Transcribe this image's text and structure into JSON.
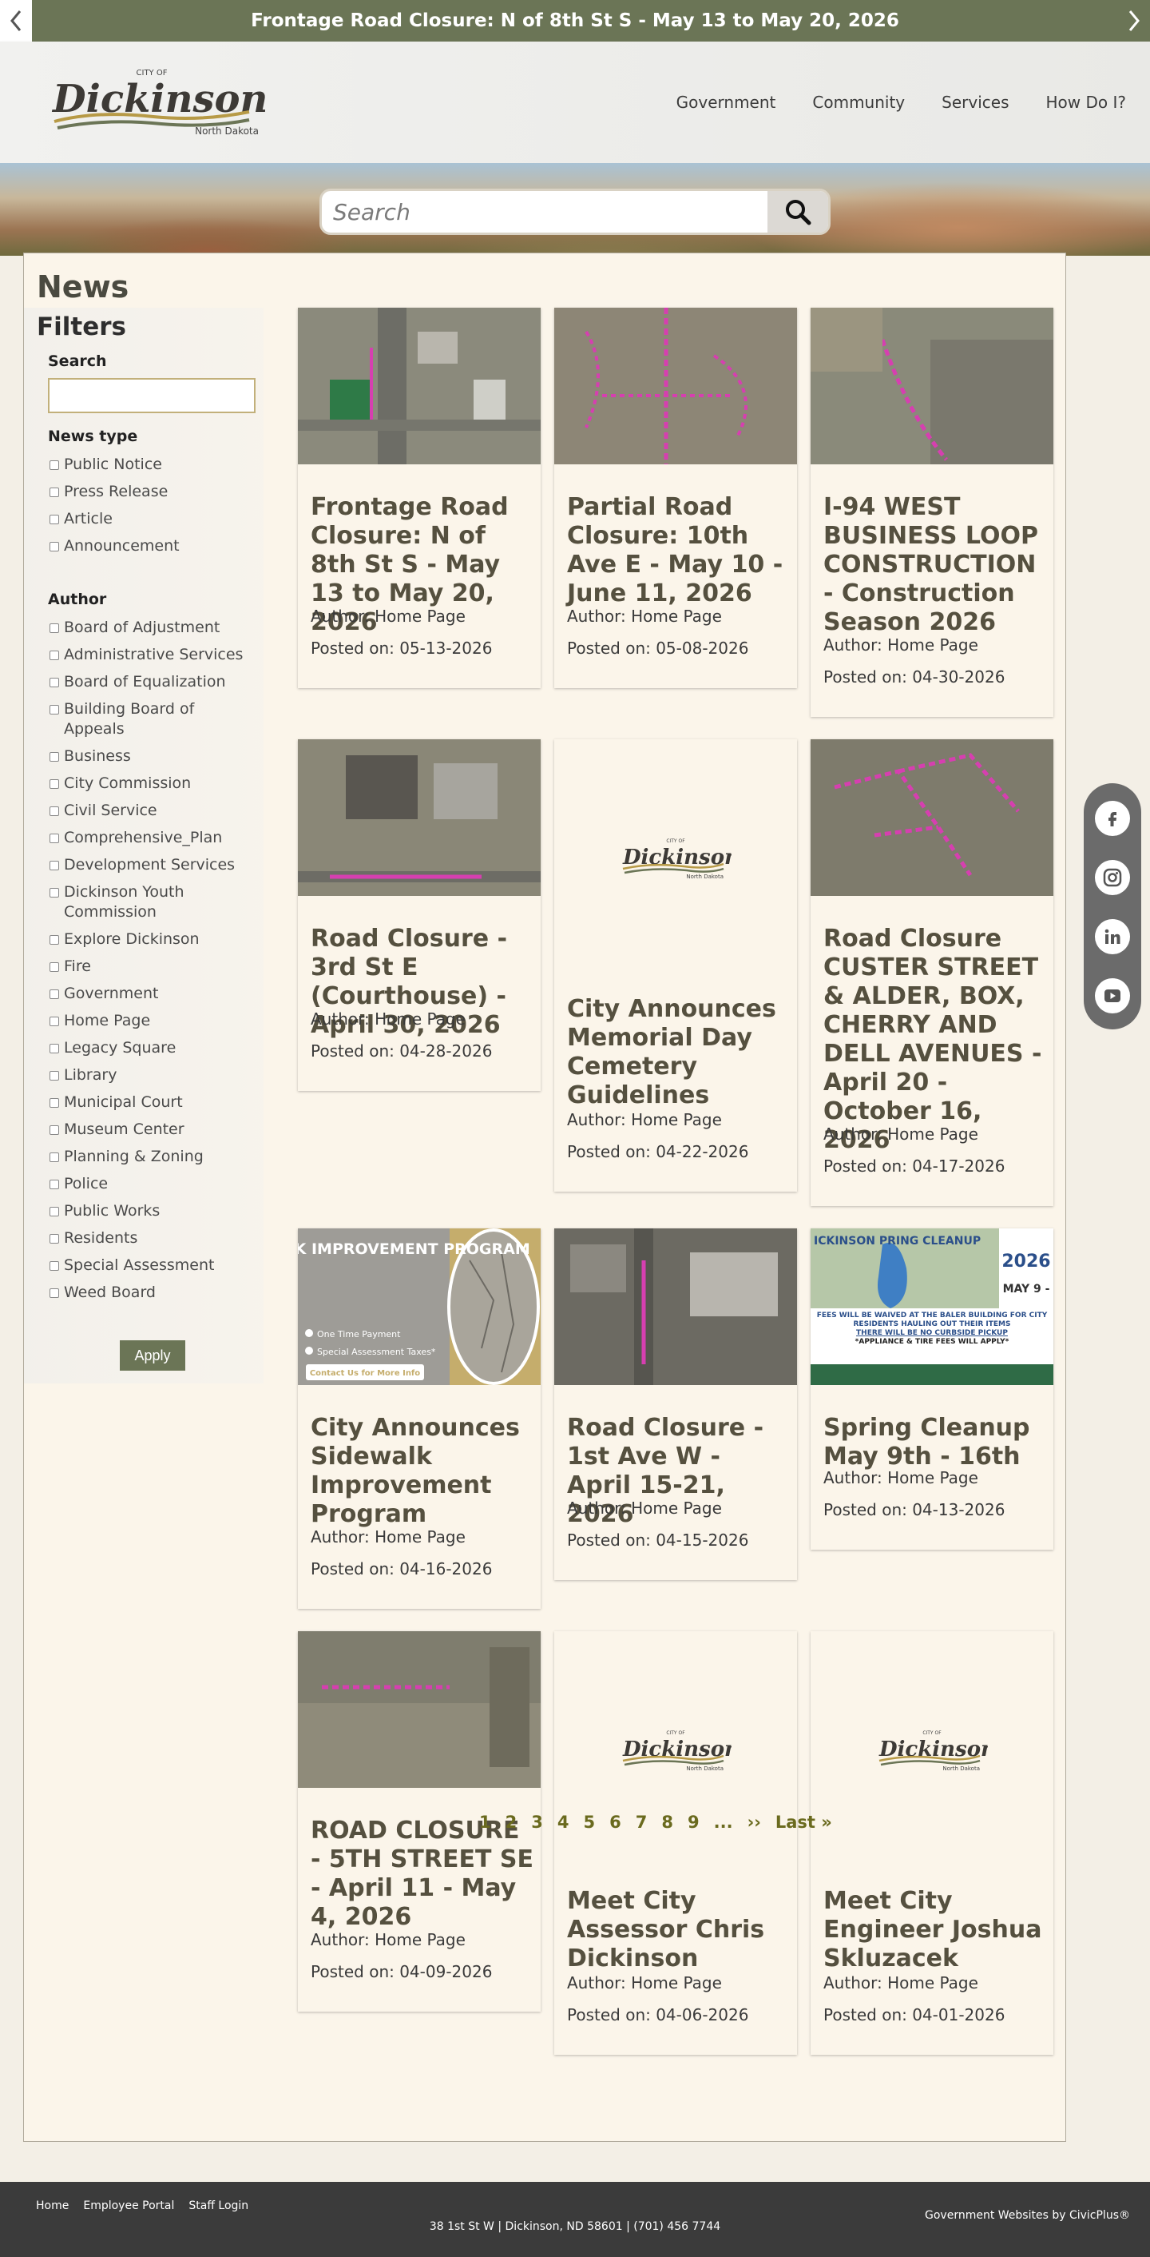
{
  "alert": {
    "text": "Frontage Road Closure: N of 8th St S - May 13 to May 20, 2026"
  },
  "header": {
    "logo": {
      "top_text": "CITY OF",
      "main_text": "Dickinson",
      "sub_text": "North Dakota"
    },
    "nav": [
      "Government",
      "Community",
      "Services",
      "How Do I?"
    ]
  },
  "search": {
    "placeholder": "Search"
  },
  "page": {
    "title": "News"
  },
  "filters": {
    "title": "Filters",
    "search_label": "Search",
    "news_type_label": "News type",
    "news_types": [
      "Public Notice",
      "Press Release",
      "Article",
      "Announcement"
    ],
    "author_label": "Author",
    "authors": [
      "Board of Adjustment",
      "Administrative Services",
      "Board of Equalization",
      "Building Board of Appeals",
      "Business",
      "City Commission",
      "Civil Service",
      "Comprehensive_Plan",
      "Development Services",
      "Dickinson Youth Commission",
      "Explore Dickinson",
      "Fire",
      "Government",
      "Home Page",
      "Legacy Square",
      "Library",
      "Municipal Court",
      "Museum Center",
      "Planning & Zoning",
      "Police",
      "Public Works",
      "Residents",
      "Special Assessment",
      "Weed Board"
    ],
    "apply_label": "Apply"
  },
  "cards": [
    {
      "title": "Frontage Road Closure: N of 8th St S - May 13 to May 20, 2026",
      "author": "Author: Home Page",
      "date": "Posted on: 05-13-2026"
    },
    {
      "title": "Partial Road Closure: 10th Ave E - May 10 - June 11, 2026",
      "author": "Author: Home Page",
      "date": "Posted on: 05-08-2026"
    },
    {
      "title": "I-94 WEST BUSINESS LOOP CONSTRUCTION - Construction Season 2026",
      "author": "Author: Home Page",
      "date": "Posted on: 04-30-2026"
    },
    {
      "title": "Road Closure - 3rd St E (Courthouse) - April 30, 2026",
      "author": "Author: Home Page",
      "date": "Posted on: 04-28-2026"
    },
    {
      "title": "City Announces Memorial Day Cemetery Guidelines",
      "author": "Author: Home Page",
      "date": "Posted on: 04-22-2026"
    },
    {
      "title": "Road Closure CUSTER STREET & ALDER, BOX, CHERRY AND DELL AVENUES - April 20 - October 16, 2026",
      "author": "Author: Home Page",
      "date": "Posted on: 04-17-2026"
    },
    {
      "title": "City Announces Sidewalk Improvement Program",
      "author": "Author: Home Page",
      "date": "Posted on: 04-16-2026",
      "image_text": {
        "heading": "SIDEWALK IMPROVEMENT PROGRAM",
        "opt1": "One Time Payment",
        "opt2": "Special Assessment Taxes*",
        "cta": "Contact Us for More Info"
      }
    },
    {
      "title": "Road Closure - 1st Ave W - April 15-21, 2026",
      "author": "Author: Home Page",
      "date": "Posted on: 04-15-2026"
    },
    {
      "title": "Spring Cleanup May 9th - 16th",
      "author": "Author: Home Page",
      "date": "Posted on: 04-13-2026",
      "image_text": {
        "heading": "ICKINSON PRING CLEANUP",
        "year": "2026",
        "dates": "MAY 9 -",
        "line1": "FEES WILL BE WAIVED AT THE BALER BUILDING FOR CITY RESIDENTS HAULING OUT THEIR ITEMS",
        "line2": "THERE WILL BE NO CURBSIDE PICKUP",
        "line3": "*APPLIANCE & TIRE FEES WILL APPLY*"
      }
    },
    {
      "title": "ROAD CLOSURE - 5TH STREET SE - April 11 - May 4, 2026",
      "author": "Author: Home Page",
      "date": "Posted on: 04-09-2026"
    },
    {
      "title": "Meet City Assessor Chris Dickinson",
      "author": "Author: Home Page",
      "date": "Posted on: 04-06-2026"
    },
    {
      "title": "Meet City Engineer Joshua Skluzacek",
      "author": "Author: Home Page",
      "date": "Posted on: 04-01-2026"
    }
  ],
  "pagination": {
    "pages": [
      "1",
      "2",
      "3",
      "4",
      "5",
      "6",
      "7",
      "8",
      "9",
      "...",
      "››",
      "Last »"
    ]
  },
  "social": [
    "facebook-icon",
    "instagram-icon",
    "linkedin-icon",
    "youtube-icon"
  ],
  "footer": {
    "links": [
      "Home",
      "Employee Portal",
      "Staff Login"
    ],
    "address": "38 1st St W | Dickinson, ND 58601 | (701) 456 7744",
    "credit": "Government Websites by CivicPlus®"
  },
  "colors": {
    "accent": "#6b7556",
    "title_text": "#55503f",
    "page_bg": "#fbf5ea",
    "link": "#6a6a1e",
    "route_highlight": "#d63fb0"
  }
}
